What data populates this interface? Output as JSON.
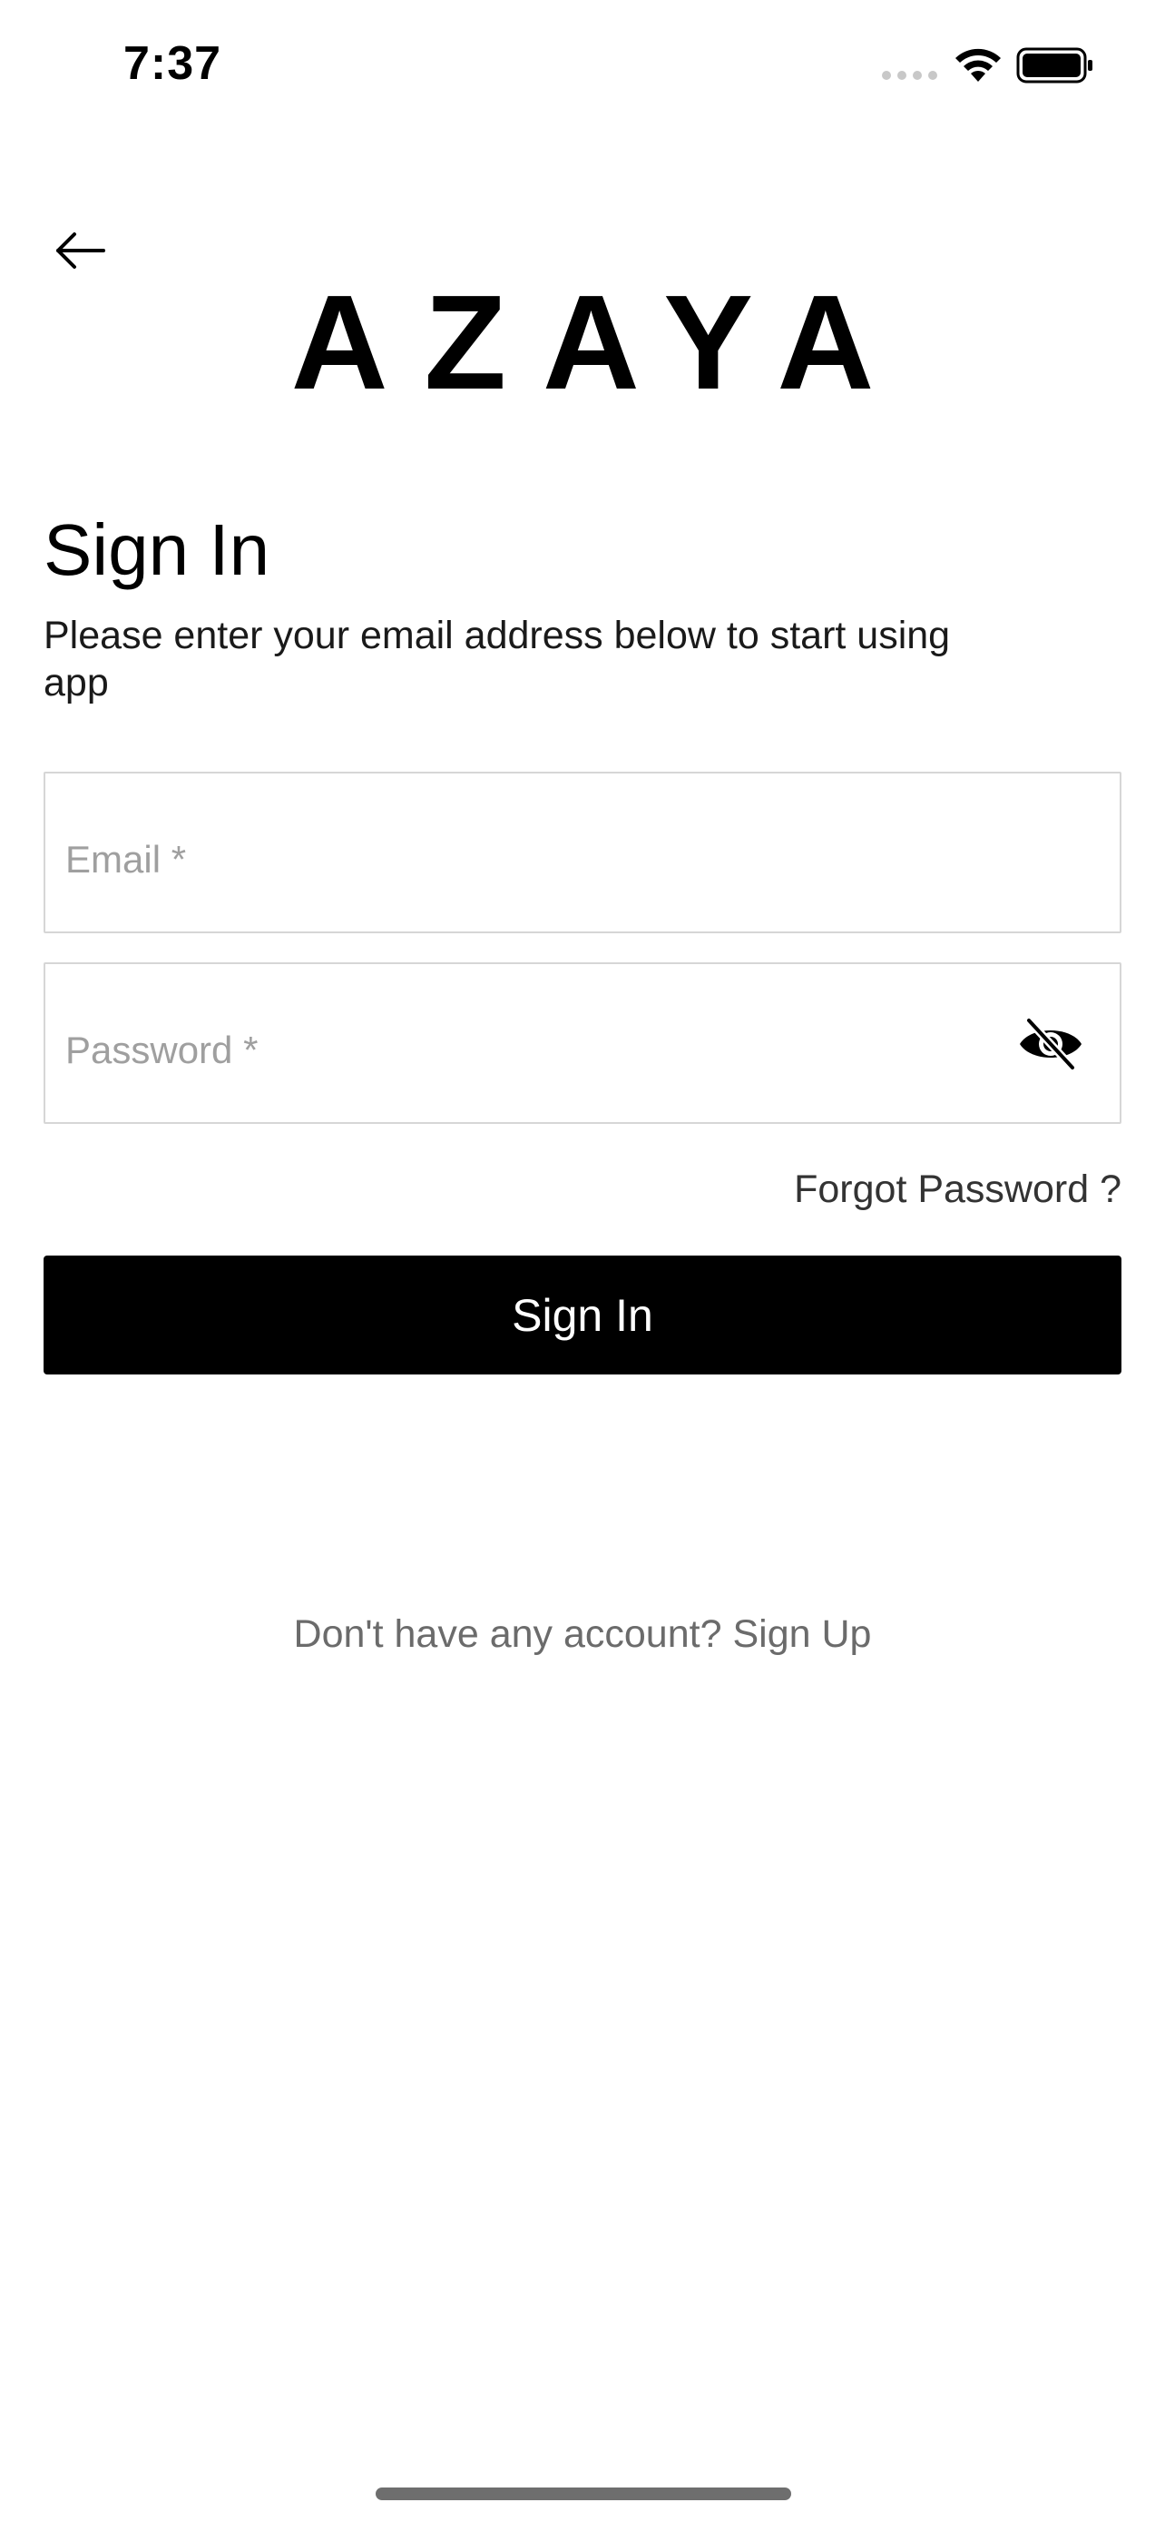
{
  "status_bar": {
    "time": "7:37",
    "icons": [
      "signal-dots-icon",
      "wifi-icon",
      "battery-icon"
    ]
  },
  "header": {
    "back_icon": "arrow-left-icon",
    "logo_text": "AZAYA"
  },
  "form": {
    "title": "Sign In",
    "subtitle": "Please enter your email address below to start using app",
    "email": {
      "placeholder": "Email *",
      "value": ""
    },
    "password": {
      "placeholder": "Password *",
      "value": "",
      "toggle_icon": "eye-off-icon"
    },
    "forgot_password": "Forgot Password ?",
    "submit_label": "Sign In"
  },
  "footer": {
    "prompt": "Don't have any account?",
    "signup_label": "Sign Up"
  },
  "colors": {
    "primary": "#000000",
    "background": "#ffffff",
    "placeholder": "#9f9f9f",
    "border": "#d6d6d6",
    "muted_text": "#6b6b6b"
  }
}
